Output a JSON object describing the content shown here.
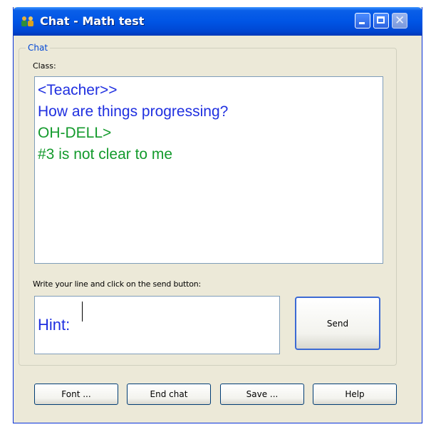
{
  "window": {
    "title": "Chat - Math test"
  },
  "chat_group": {
    "legend": "Chat",
    "class_label": "Class:",
    "messages": [
      {
        "text": "<Teacher>>",
        "color": "#1f2fe0"
      },
      {
        "text": "How are things progressing?",
        "color": "#1f2fe0"
      },
      {
        "text": "OH-DELL>",
        "color": "#139a2c"
      },
      {
        "text": "#3 is not clear to me",
        "color": "#139a2c"
      }
    ],
    "write_label": "Write your line and click on the send button:",
    "input_value": "Hint:",
    "input_color": "#1f2fe0",
    "send_label": "Send"
  },
  "buttons": {
    "font": "Font ...",
    "end_chat": "End chat",
    "save": "Save ...",
    "help": "Help"
  },
  "icons": {
    "app": "chat-users-icon",
    "minimize": "minimize-icon",
    "maximize": "maximize-icon",
    "close": "close-icon"
  }
}
